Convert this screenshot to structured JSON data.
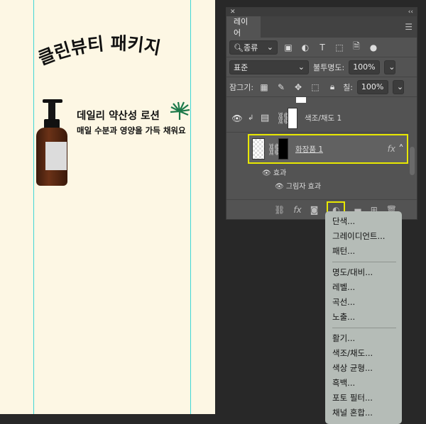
{
  "canvas": {
    "title": "클린뷰티 패키지",
    "product_name": "데일리 약산성 로션",
    "product_desc": "매일 수분과 영양을 가득 채워요"
  },
  "panel": {
    "close": "✕",
    "collapse": "‹‹",
    "tab": "레이어",
    "filter_kind": "종류",
    "blend_mode": "표준",
    "opacity_label": "불투명도:",
    "opacity": "100%",
    "lock_label": "잠그기:",
    "fill_label": "칠:",
    "fill": "100%"
  },
  "layers": [
    {
      "name": "색조/채도 1"
    },
    {
      "name": "화장품 1",
      "fx": "fx",
      "effects_label": "효과",
      "effect": "그림자 효과"
    }
  ],
  "bottom": {
    "fx": "fx"
  },
  "menu": {
    "group1": [
      "단색...",
      "그레이디언트...",
      "패턴..."
    ],
    "group2": [
      "명도/대비...",
      "레벨...",
      "곡선...",
      "노출..."
    ],
    "group3": [
      "활기...",
      "색조/채도...",
      "색상 균형...",
      "흑백...",
      "포토 필터...",
      "채널 혼합..."
    ]
  },
  "colors": {
    "highlight": "#e8e800",
    "guide": "#3fd6d6",
    "canvas": "#fdf7e4"
  }
}
